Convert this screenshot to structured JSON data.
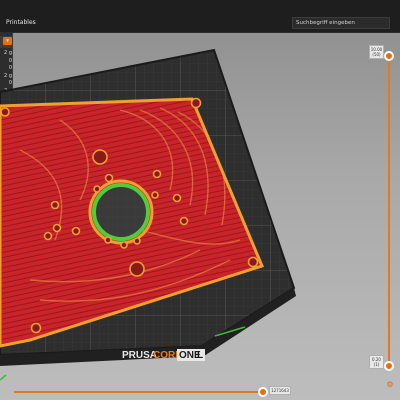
{
  "topbar": {
    "tab_label": "Printables",
    "search_placeholder": "Suchbegriff eingeben"
  },
  "side_panel": {
    "header_icon": "chevron-down-icon",
    "rows": [
      "2 g",
      "0",
      "0",
      "2 g",
      "0",
      "2 g",
      "0",
      "2 g",
      "0",
      "0",
      "0"
    ]
  },
  "bed": {
    "brand_prusa": "PRUSA",
    "brand_core": "CORE",
    "brand_one": "ONE",
    "brand_l": "L"
  },
  "sliders": {
    "vertical_top_label": "10.00",
    "vertical_top_sublabel": "(50)",
    "vertical_bottom_label": "0.20",
    "vertical_bottom_sublabel": "(1)",
    "horizontal_label": "1271643",
    "settings_icon": "gear-icon"
  },
  "colors": {
    "accent": "#e36f12",
    "perimeter": "#f0a030",
    "infill": "#c8242a",
    "support": "#4fce3c",
    "bed": "#2e2e2e"
  }
}
